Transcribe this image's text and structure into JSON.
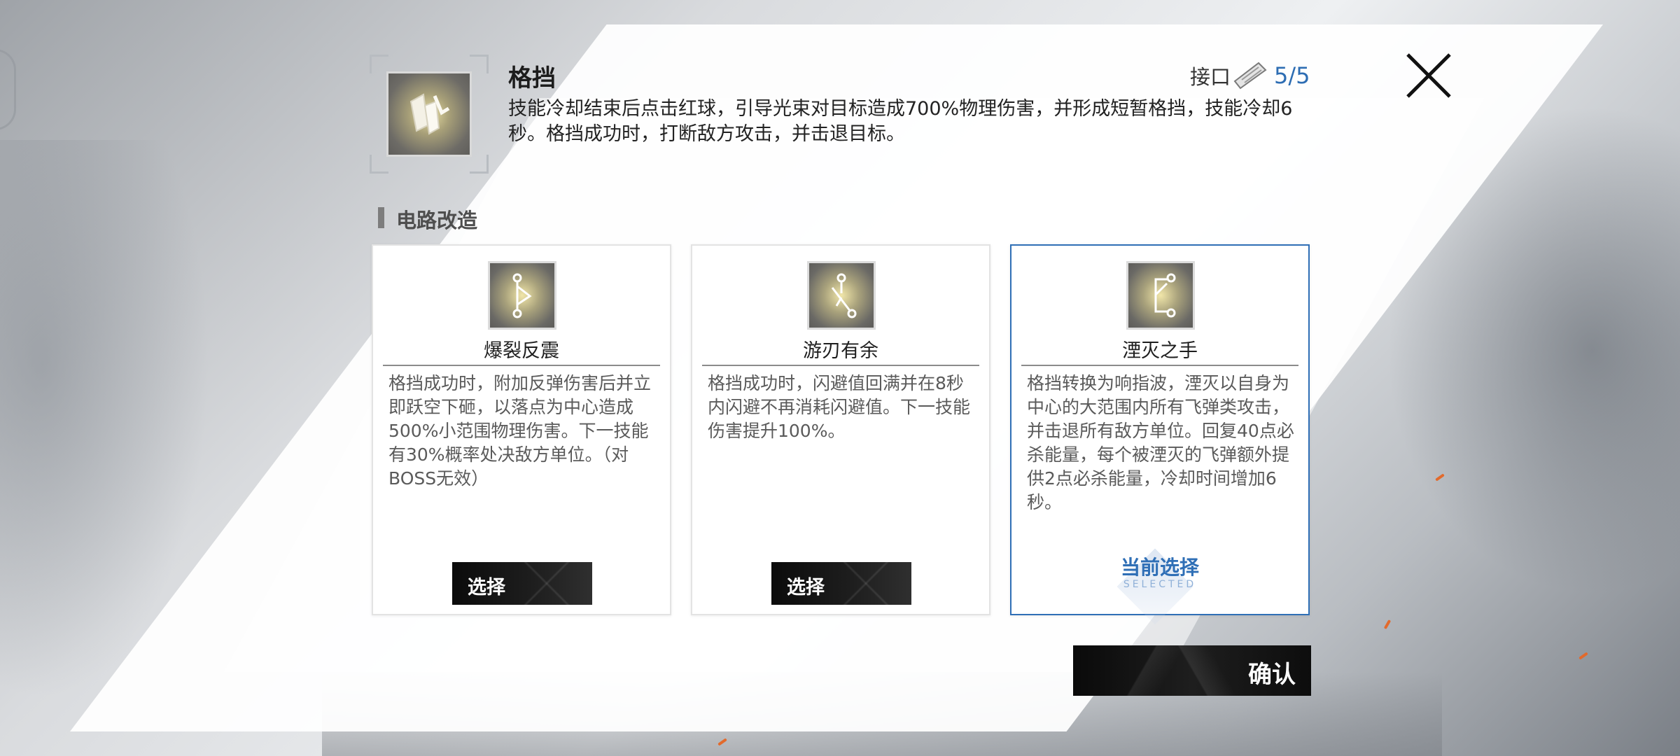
{
  "skill": {
    "title": "格挡",
    "description": "技能冷却结束后点击红球，引导光束对目标造成700%物理伤害，并形成短暂格挡，技能冷却6秒。格挡成功时，打断敌方攻击，并击退目标。",
    "icon": "parry-crystal-icon"
  },
  "interface": {
    "label": "接口",
    "icon": "chip-icon",
    "count": "5/5"
  },
  "section": {
    "title": "电路改造"
  },
  "cards": [
    {
      "title": "爆裂反震",
      "description": "格挡成功时，附加反弹伤害后并立即跃空下砸，以落点为中心造成500%小范围物理伤害。下一技能有30%概率处决敌方单位。（对BOSS无效）",
      "icon": "circuit-branch-icon",
      "button_label": "选择"
    },
    {
      "title": "游刃有余",
      "description": "格挡成功时，闪避值回满并在8秒内闪避不再消耗闪避值。下一技能伤害提升100%。",
      "icon": "circuit-cross-icon",
      "button_label": "选择"
    },
    {
      "title": "湮灭之手",
      "description": "格挡转换为响指波，湮灭以自身为中心的大范围内所有飞弹类攻击，并击退所有敌方单位。回复40点必杀能量，每个被湮灭的飞弹额外提供2点必杀能量，冷却时间增加6秒。",
      "icon": "circuit-bracket-icon",
      "selected_label": "当前选择",
      "selected_sub": "SELECTED"
    }
  ],
  "confirm_label": "确认",
  "colors": {
    "accent": "#2f6fb6",
    "button_dark": "#111111"
  }
}
